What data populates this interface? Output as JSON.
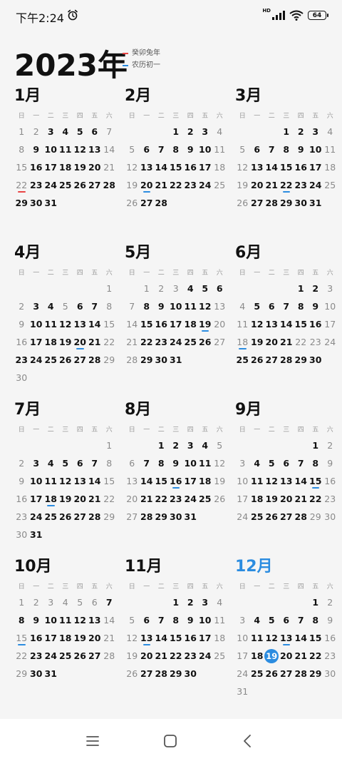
{
  "status": {
    "time": "下午2:24",
    "hd": "HD",
    "battery": "64"
  },
  "header": {
    "year": "2023年",
    "legend": [
      {
        "label": "癸卯兔年",
        "color": "#e94545"
      },
      {
        "label": "农历初一",
        "color": "#2b8ce0"
      }
    ]
  },
  "weekdays": [
    "日",
    "一",
    "二",
    "三",
    "四",
    "五",
    "六"
  ],
  "months": [
    {
      "label": "1月",
      "start": 0,
      "days": 31,
      "markers": {
        "22": "red"
      },
      "current": false
    },
    {
      "label": "2月",
      "start": 3,
      "days": 28,
      "markers": {
        "20": "blue"
      },
      "current": false
    },
    {
      "label": "3月",
      "start": 3,
      "days": 31,
      "markers": {
        "22": "blue"
      },
      "current": false
    },
    {
      "label": "4月",
      "start": 6,
      "days": 30,
      "markers": {
        "20": "blue"
      },
      "current": false
    },
    {
      "label": "5月",
      "start": 1,
      "days": 31,
      "markers": {
        "19": "blue"
      },
      "current": false
    },
    {
      "label": "6月",
      "start": 4,
      "days": 30,
      "markers": {
        "18": "blue"
      },
      "current": false
    },
    {
      "label": "7月",
      "start": 6,
      "days": 31,
      "markers": {
        "18": "blue"
      },
      "current": false
    },
    {
      "label": "8月",
      "start": 2,
      "days": 31,
      "markers": {
        "16": "blue"
      },
      "current": false
    },
    {
      "label": "9月",
      "start": 5,
      "days": 30,
      "markers": {
        "15": "blue"
      },
      "current": false
    },
    {
      "label": "10月",
      "start": 0,
      "days": 31,
      "markers": {
        "15": "blue"
      },
      "current": false
    },
    {
      "label": "11月",
      "start": 3,
      "days": 30,
      "markers": {
        "13": "blue"
      },
      "current": false
    },
    {
      "label": "12月",
      "start": 5,
      "days": 31,
      "markers": {
        "13": "blue"
      },
      "current": true,
      "today": 19
    }
  ],
  "holidays_offdays": {
    "1月": [
      1,
      2
    ],
    "4月": [
      5
    ],
    "5月": [
      1,
      2,
      3
    ],
    "6月": [
      22,
      23,
      24
    ],
    "9月": [
      29,
      30
    ],
    "10月": [
      1,
      2,
      3,
      4,
      5,
      6
    ]
  },
  "workdays": {
    "1月": [
      28,
      29
    ],
    "4月": [
      23
    ],
    "5月": [
      6
    ],
    "6月": [
      25
    ],
    "10月": [
      7,
      8
    ]
  },
  "nav": {
    "menu_icon": "menu-icon",
    "home_icon": "home-icon",
    "back_icon": "back-icon"
  }
}
